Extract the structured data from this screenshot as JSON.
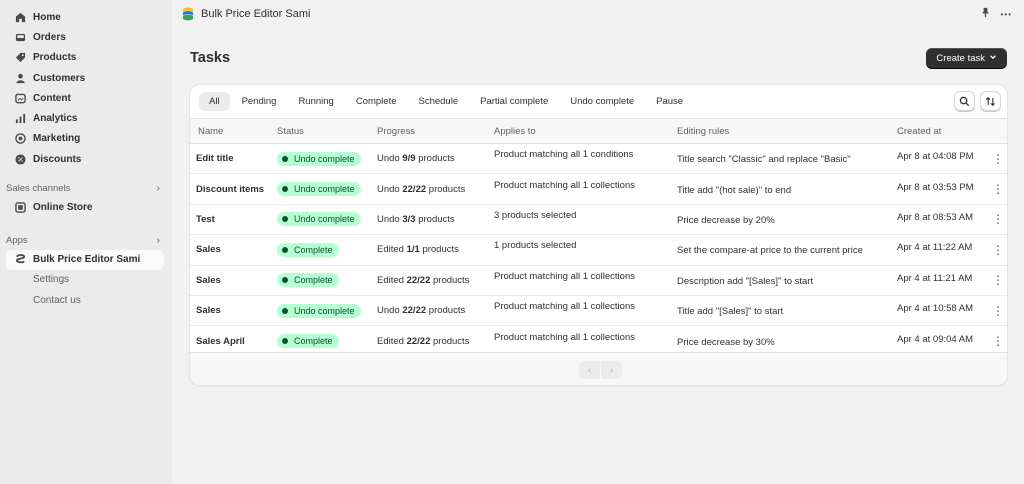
{
  "sidebar": {
    "items": [
      {
        "label": "Home",
        "icon": "home-icon"
      },
      {
        "label": "Orders",
        "icon": "inbox-icon"
      },
      {
        "label": "Products",
        "icon": "tag-icon"
      },
      {
        "label": "Customers",
        "icon": "person-icon"
      },
      {
        "label": "Content",
        "icon": "image-icon"
      },
      {
        "label": "Analytics",
        "icon": "chart-icon"
      },
      {
        "label": "Marketing",
        "icon": "target-icon"
      },
      {
        "label": "Discounts",
        "icon": "discount-icon"
      }
    ],
    "sales_channels_label": "Sales channels",
    "online_store_label": "Online Store",
    "apps_label": "Apps",
    "app_name": "Bulk Price Editor Sami",
    "settings_label": "Settings",
    "contact_label": "Contact us"
  },
  "topbar": {
    "title": "Bulk Price Editor Sami",
    "more": "•••"
  },
  "page": {
    "title": "Tasks",
    "create_label": "Create task"
  },
  "tabs": [
    "All",
    "Pending",
    "Running",
    "Complete",
    "Schedule",
    "Partial complete",
    "Undo complete",
    "Pause"
  ],
  "columns": {
    "name": "Name",
    "status": "Status",
    "progress": "Progress",
    "applies": "Applies to",
    "rules": "Editing rules",
    "created": "Created at"
  },
  "rows": [
    {
      "name": "Edit title",
      "status": "Undo complete",
      "progress_prefix": "Undo",
      "progress_count": "9/9",
      "progress_suffix": "products",
      "applies": "Product matching all 1 conditions",
      "rules": "Title search \"Classic\" and replace \"Basic\"",
      "created": "Apr 8 at 04:08 PM"
    },
    {
      "name": "Discount items",
      "status": "Undo complete",
      "progress_prefix": "Undo",
      "progress_count": "22/22",
      "progress_suffix": "products",
      "applies": "Product matching all 1 collections",
      "rules": "Title add \"(hot sale)\" to end",
      "created": "Apr 8 at 03:53 PM"
    },
    {
      "name": "Test",
      "status": "Undo complete",
      "progress_prefix": "Undo",
      "progress_count": "3/3",
      "progress_suffix": "products",
      "applies": "3 products selected",
      "rules": "Price decrease by 20%",
      "created": "Apr 8 at 08:53 AM"
    },
    {
      "name": "Sales",
      "status": "Complete",
      "progress_prefix": "Edited",
      "progress_count": "1/1",
      "progress_suffix": "products",
      "applies": "1 products selected",
      "rules": "Set the compare-at price to the current price",
      "created": "Apr 4 at 11:22 AM"
    },
    {
      "name": "Sales",
      "status": "Complete",
      "progress_prefix": "Edited",
      "progress_count": "22/22",
      "progress_suffix": "products",
      "applies": "Product matching all 1 collections",
      "rules": "Description add \"[Sales]\" to start",
      "created": "Apr 4 at 11:21 AM"
    },
    {
      "name": "Sales",
      "status": "Undo complete",
      "progress_prefix": "Undo",
      "progress_count": "22/22",
      "progress_suffix": "products",
      "applies": "Product matching all 1 collections",
      "rules": "Title add \"[Sales]\" to start",
      "created": "Apr 4 at 10:58 AM"
    },
    {
      "name": "Sales April",
      "status": "Complete",
      "progress_prefix": "Edited",
      "progress_count": "22/22",
      "progress_suffix": "products",
      "applies": "Product matching all 1 collections",
      "rules": "Price decrease by 30%",
      "created": "Apr 4 at 09:04 AM"
    }
  ],
  "colors": {
    "badge_bg": "#b4fed2",
    "badge_fg": "#0c5132",
    "primary_btn": "#303030"
  }
}
